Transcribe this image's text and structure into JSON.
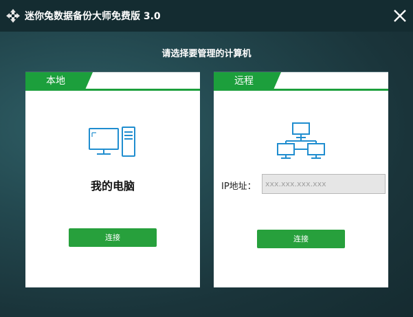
{
  "window": {
    "title": "迷你兔数据备份大师免费版 3.0"
  },
  "prompt": "请选择要管理的计算机",
  "local": {
    "tab": "本地",
    "label": "我的电脑",
    "connect": "连接"
  },
  "remote": {
    "tab": "远程",
    "ip_label": "IP地址：",
    "ip_value": "",
    "ip_placeholder": "xxx.xxx.xxx.xxx",
    "connect": "连接"
  },
  "colors": {
    "accent": "#1c9f3c",
    "icon": "#1f8dcf",
    "titlebar": "#142c31"
  },
  "icons": [
    "app-logo-icon",
    "close-icon",
    "computer-icon",
    "network-icon"
  ]
}
